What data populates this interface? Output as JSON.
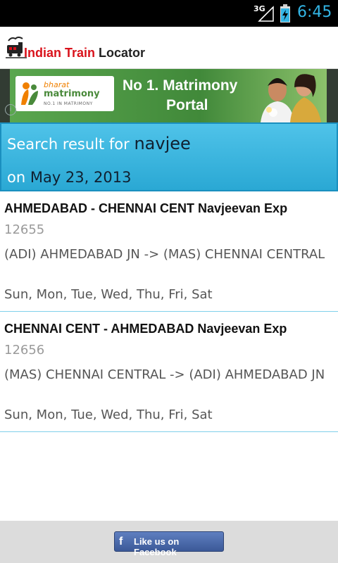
{
  "status_bar": {
    "network": "3G",
    "time": "6:45",
    "accent": "#33b5e5"
  },
  "header": {
    "title_part1": "Indian Train",
    "title_part2": " Locator"
  },
  "ad": {
    "brand_line1": "bharat",
    "brand_line2": "matrimony",
    "brand_line3": "NO.1 IN MATRIMONY",
    "headline1": "No 1. Matrimony",
    "headline2": "Portal"
  },
  "search": {
    "prefix": "Search result for ",
    "query": "navjee",
    "date_prefix": "on ",
    "date": "May 23, 2013"
  },
  "results": [
    {
      "title": "AHMEDABAD - CHENNAI CENT Navjeevan Exp",
      "number": "12655",
      "route": "(ADI) AHMEDABAD JN -> (MAS) CHENNAI CENTRAL",
      "days": "Sun, Mon, Tue, Wed, Thu, Fri, Sat"
    },
    {
      "title": "CHENNAI CENT - AHMEDABAD Navjeevan Exp",
      "number": "12656",
      "route": "(MAS) CHENNAI CENTRAL -> (ADI) AHMEDABAD JN",
      "days": "Sun, Mon, Tue, Wed, Thu, Fri, Sat"
    }
  ],
  "footer": {
    "facebook_label": "Like us on Facebook"
  },
  "icons": {
    "app_logo": "train-icon",
    "ad_info": "info-icon",
    "facebook": "facebook-icon"
  }
}
